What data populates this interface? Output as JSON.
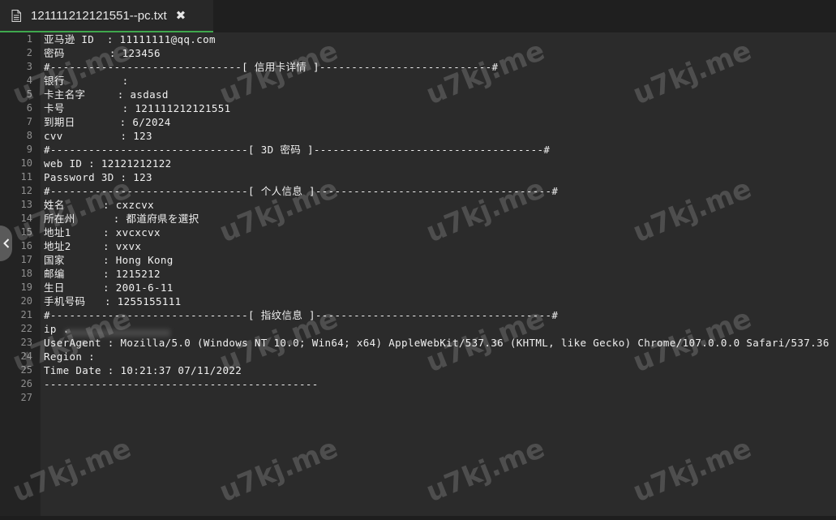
{
  "tab": {
    "title": "121111212121551--pc.txt",
    "close_glyph": "✖",
    "accent_color": "#3fa84d"
  },
  "icons": {
    "file": "file-text-icon",
    "close": "close-icon",
    "collapse": "chevron-left-icon"
  },
  "lines": [
    {
      "n": "1",
      "t": "亚马逊 ID  : 11111111@qq.com"
    },
    {
      "n": "2",
      "t": "密码       : 123456"
    },
    {
      "n": "3",
      "t": "#------------------------------[ 信用卡详情 ]---------------------------#"
    },
    {
      "n": "4",
      "t": "银行         :"
    },
    {
      "n": "5",
      "t": "卡主名字     : asdasd"
    },
    {
      "n": "6",
      "t": "卡号         : 121111212121551"
    },
    {
      "n": "7",
      "t": "到期日       : 6/2024"
    },
    {
      "n": "8",
      "t": "cvv         : 123"
    },
    {
      "n": "9",
      "t": "#-------------------------------[ 3D 密码 ]------------------------------------#"
    },
    {
      "n": "10",
      "t": "web ID : 12121212122"
    },
    {
      "n": "11",
      "t": "Password 3D : 123"
    },
    {
      "n": "12",
      "t": "#-------------------------------[ 个人信息 ]-------------------------------------#"
    },
    {
      "n": "13",
      "t": "姓名      : cxzcvx"
    },
    {
      "n": "14",
      "t": "所在州      : 都道府県を選択"
    },
    {
      "n": "15",
      "t": "地址1     : xvcxcvx"
    },
    {
      "n": "16",
      "t": "地址2     : vxvx"
    },
    {
      "n": "17",
      "t": "国家      : Hong Kong"
    },
    {
      "n": "18",
      "t": "邮编      : 1215212"
    },
    {
      "n": "19",
      "t": "生日      : 2001-6-11"
    },
    {
      "n": "20",
      "t": "手机号码   : 1255155111"
    },
    {
      "n": "21",
      "t": "#-------------------------------[ 指纹信息 ]-------------------------------------#"
    },
    {
      "n": "22",
      "t": "ip ."
    },
    {
      "n": "23",
      "t": "UserAgent : Mozilla/5.0 (Windows NT 10.0; Win64; x64) AppleWebKit/537.36 (KHTML, like Gecko) Chrome/107.0.0.0 Safari/537.36"
    },
    {
      "n": "24",
      "t": "Region :"
    },
    {
      "n": "25",
      "t": "Time Date : 10:21:37 07/11/2022"
    },
    {
      "n": "26",
      "t": "-------------------------------------------"
    },
    {
      "n": "27",
      "t": ""
    }
  ],
  "watermark": "u7kj.me"
}
